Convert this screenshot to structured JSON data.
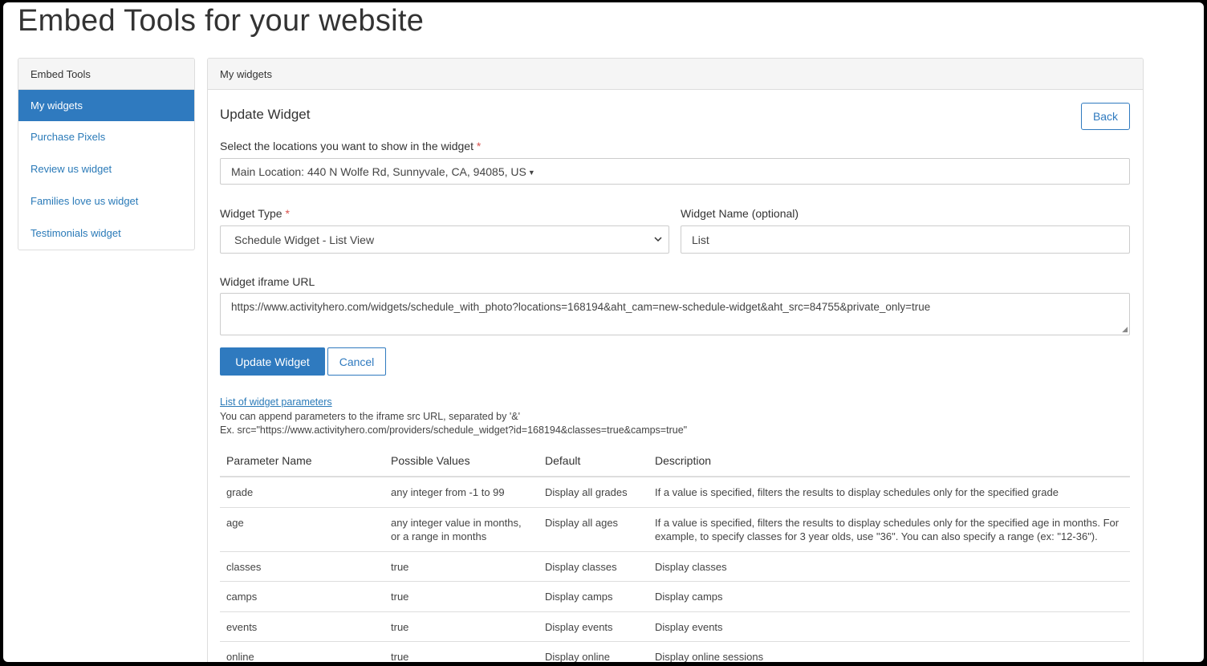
{
  "page": {
    "title": "Embed Tools for your website"
  },
  "sidebar": {
    "header": "Embed Tools",
    "items": [
      {
        "label": "My widgets"
      },
      {
        "label": "Purchase Pixels"
      },
      {
        "label": "Review us widget"
      },
      {
        "label": "Families love us widget"
      },
      {
        "label": "Testimonials widget"
      }
    ]
  },
  "panel": {
    "header": "My widgets",
    "title": "Update Widget",
    "back_label": "Back",
    "locations": {
      "label": "Select the locations you want to show in the widget",
      "required_mark": "*",
      "value": "Main Location: 440 N Wolfe Rd, Sunnyvale, CA, 94085, US"
    },
    "widget_type": {
      "label": "Widget Type",
      "required_mark": "*",
      "value": "Schedule Widget - List View"
    },
    "widget_name": {
      "label": "Widget Name (optional)",
      "value": "List"
    },
    "iframe_url": {
      "label": "Widget iframe URL",
      "value": "https://www.activityhero.com/widgets/schedule_with_photo?locations=168194&aht_cam=new-schedule-widget&aht_src=84755&private_only=true"
    },
    "update_label": "Update Widget",
    "cancel_label": "Cancel",
    "params_link": "List of widget parameters",
    "help_line1": "You can append parameters to the iframe src URL, separated by '&'",
    "help_line2": "Ex. src=\"https://www.activityhero.com/providers/schedule_widget?id=168194&classes=true&camps=true\"",
    "table": {
      "headers": [
        "Parameter Name",
        "Possible Values",
        "Default",
        "Description"
      ],
      "rows": [
        [
          "grade",
          "any integer from -1 to 99",
          "Display all grades",
          "If a value is specified, filters the results to display schedules only for the specified grade"
        ],
        [
          "age",
          "any integer value in months, or a range in months",
          "Display all ages",
          "If a value is specified, filters the results to display schedules only for the specified age in months. For example, to specify classes for 3 year olds, use \"36\". You can also specify a range (ex: \"12-36\")."
        ],
        [
          "classes",
          "true",
          "Display classes",
          "Display classes"
        ],
        [
          "camps",
          "true",
          "Display camps",
          "Display camps"
        ],
        [
          "events",
          "true",
          "Display events",
          "Display events"
        ],
        [
          "online",
          "true",
          "Display online",
          "Display online sessions"
        ]
      ]
    }
  }
}
